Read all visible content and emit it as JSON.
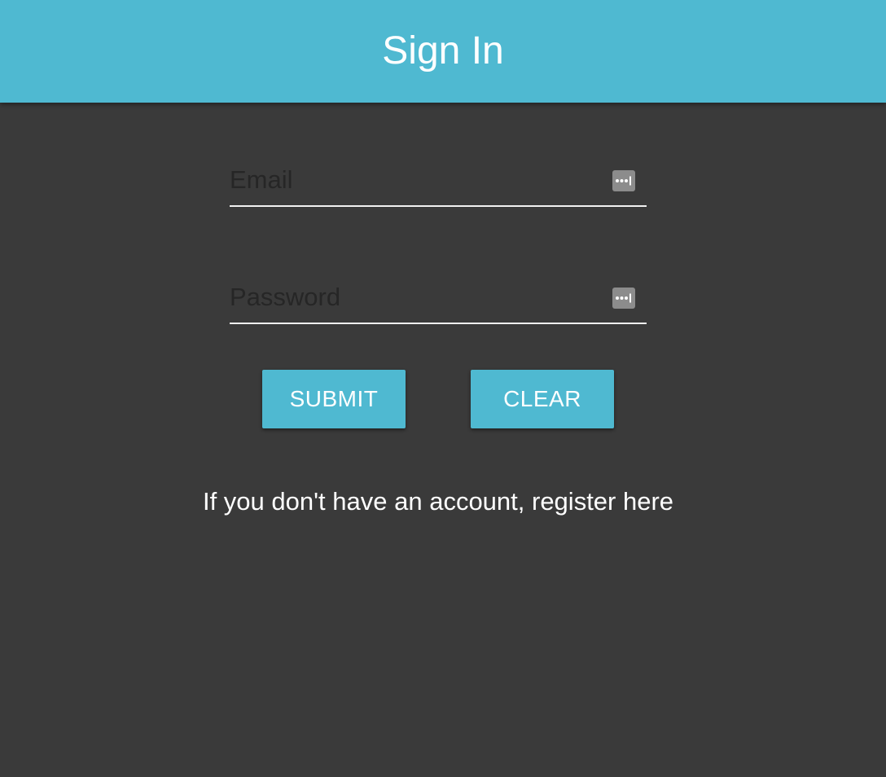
{
  "header": {
    "title": "Sign In"
  },
  "form": {
    "email": {
      "placeholder": "Email",
      "value": "",
      "icon": "password-manager-icon"
    },
    "password": {
      "placeholder": "Password",
      "value": "",
      "icon": "password-manager-icon"
    }
  },
  "buttons": {
    "submit_label": "SUBMIT",
    "clear_label": "CLEAR"
  },
  "footer": {
    "register_text": "If you don't have an account, register here"
  },
  "colors": {
    "accent": "#4fb9d1",
    "background": "#3a3a3a",
    "text": "#ffffff",
    "placeholder": "#262626",
    "icon_bg": "#8c8c8c"
  }
}
